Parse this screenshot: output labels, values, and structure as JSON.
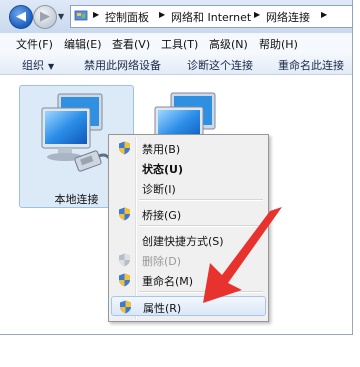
{
  "breadcrumbs": [
    "控制面板",
    "网络和 Internet",
    "网络连接"
  ],
  "menu": [
    "文件(F)",
    "编辑(E)",
    "查看(V)",
    "工具(T)",
    "高级(N)",
    "帮助(H)"
  ],
  "toolbar": {
    "organize": "组织",
    "disable_device": "禁用此网络设备",
    "diagnose": "诊断这个连接",
    "rename": "重命名此连接"
  },
  "connections": [
    {
      "label": "本地连接"
    },
    {
      "label": ""
    }
  ],
  "context_menu": {
    "disable": "禁用(B)",
    "status": "状态(U)",
    "diagnose": "诊断(I)",
    "bridge": "桥接(G)",
    "shortcut": "创建快捷方式(S)",
    "delete": "删除(D)",
    "rename": "重命名(M)",
    "properties": "属性(R)"
  },
  "colors": {
    "arrow": "#e8322e",
    "selection": "#dce9f7",
    "accent": "#1b5ec2"
  }
}
